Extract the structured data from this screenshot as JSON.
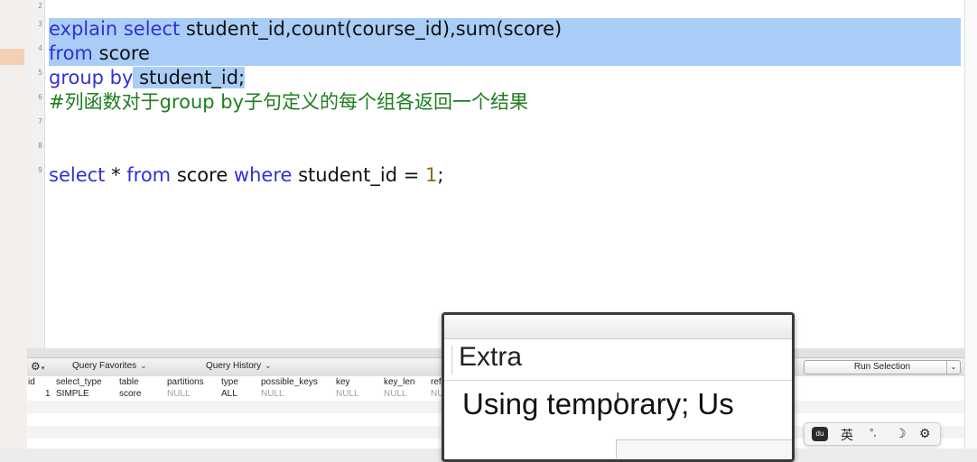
{
  "editor": {
    "lines": [
      {
        "num": "2",
        "text": ""
      },
      {
        "num": "3",
        "parts": [
          [
            "explain select",
            "kw"
          ],
          [
            " student_id,count(course_id),sum(score)",
            ""
          ]
        ]
      },
      {
        "num": "4",
        "parts": [
          [
            "from",
            "kw"
          ],
          [
            " score",
            ""
          ]
        ]
      },
      {
        "num": "5",
        "parts": [
          [
            "group by",
            "kw"
          ],
          [
            " student_id;",
            ""
          ]
        ]
      },
      {
        "num": "6",
        "parts": [
          [
            "#列函数对于group by子句定义的每个组各返回一个结果",
            "cm"
          ]
        ]
      },
      {
        "num": "7",
        "text": ""
      },
      {
        "num": "8",
        "text": ""
      },
      {
        "num": "9",
        "parts": [
          [
            "select",
            "kw"
          ],
          [
            " * ",
            ""
          ],
          [
            "from",
            "kw"
          ],
          [
            " score ",
            ""
          ],
          [
            "where",
            "kw"
          ],
          [
            " student_id = ",
            ""
          ],
          [
            "1",
            "num"
          ],
          [
            ";",
            ""
          ]
        ]
      }
    ]
  },
  "toolbar": {
    "gear_label": "⚙",
    "query_favorites": "Query Favorites",
    "query_history": "Query History",
    "run_selection": "Run Selection"
  },
  "results": {
    "columns": [
      "id",
      "select_type",
      "table",
      "partitions",
      "type",
      "possible_keys",
      "key",
      "key_len",
      "ref"
    ],
    "rows": [
      [
        "1",
        "SIMPLE",
        "score",
        "NULL",
        "ALL",
        "NULL",
        "NULL",
        "NULL",
        "NU"
      ]
    ]
  },
  "zoom": {
    "header": "Extra",
    "value": "Using temporary; Us"
  },
  "ime": {
    "logo": "du",
    "lang": "英",
    "punct": "°,",
    "moon": "☽",
    "settings": "⚙"
  },
  "colors": {
    "keyword": "#3030d8",
    "comment": "#1e7e1e",
    "selection": "#a9cdf6"
  }
}
